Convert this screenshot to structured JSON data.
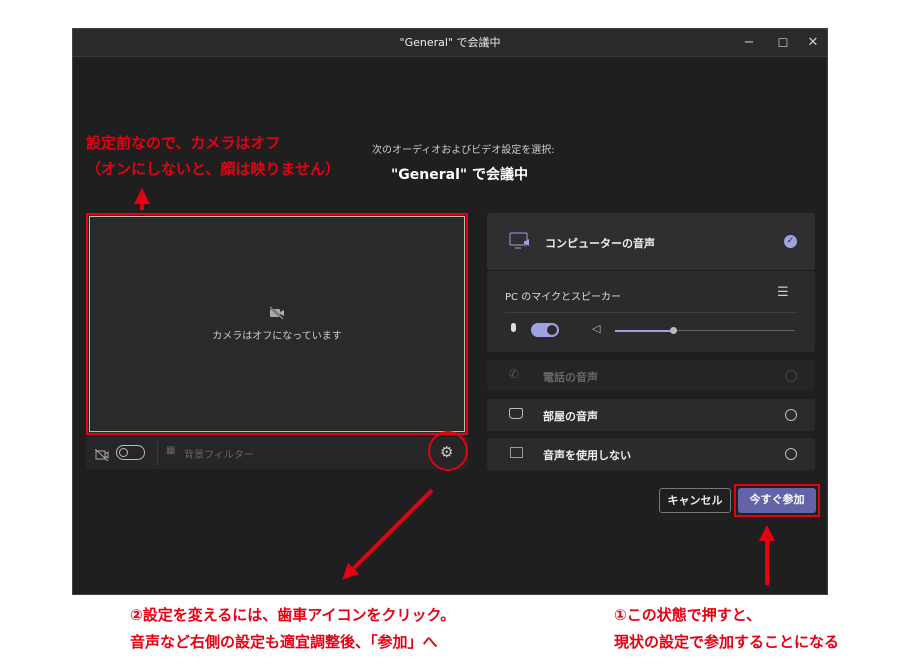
{
  "window": {
    "title": "\"General\" で会議中",
    "minimize": "−",
    "maximize": "☐",
    "close": "✕"
  },
  "header": {
    "subtitle": "次のオーディオおよびビデオ設定を選択:",
    "title": "\"General\" で会議中"
  },
  "video": {
    "status": "カメラはオフになっています",
    "background_filter": "背景フィルター",
    "camera_on": false
  },
  "audio": {
    "computer": {
      "label": "コンピューターの音声",
      "selected": true
    },
    "device": "PC のマイクとスピーカー",
    "mic_on": true,
    "volume": 0.32,
    "phone": {
      "label": "電話の音声",
      "disabled": true
    },
    "room": {
      "label": "部屋の音声"
    },
    "none": {
      "label": "音声を使用しない"
    }
  },
  "buttons": {
    "cancel": "キャンセル",
    "join": "今すぐ参加"
  },
  "annotations": {
    "camera_line1": "設定前なので、カメラはオフ",
    "camera_line2": "（オンにしないと、顔は映りません）",
    "settings_line1": "②設定を変えるには、歯車アイコンをクリック。",
    "settings_line2": "音声など右側の設定も適宜調整後、「参加」へ",
    "join_line1": "①この状態で押すと、",
    "join_line2": "現状の設定で参加することになる"
  },
  "colors": {
    "accent": "#6264a7",
    "annotation": "#e60012"
  }
}
